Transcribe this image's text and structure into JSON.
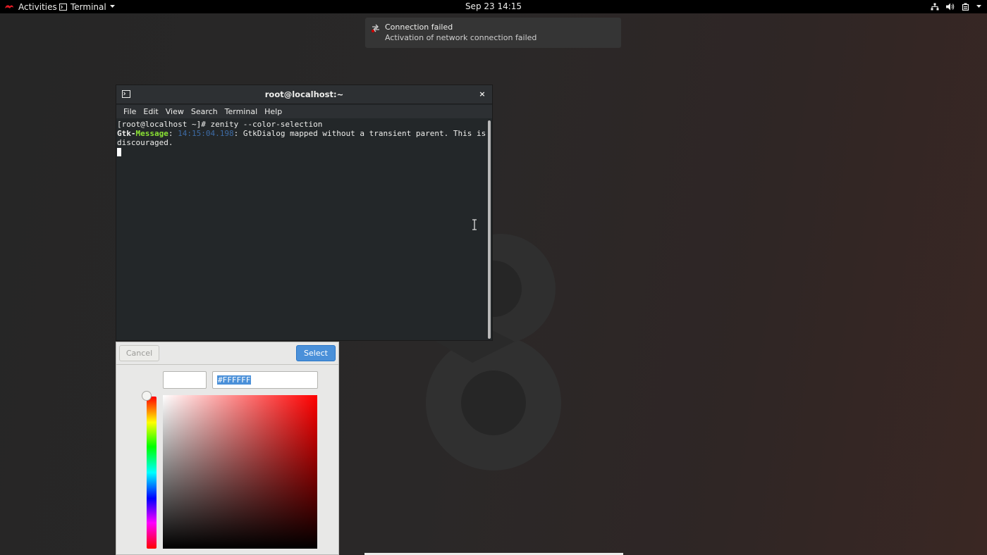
{
  "topbar": {
    "activities_label": "Activities",
    "app_menu_label": "Terminal",
    "clock": "Sep 23  14:15"
  },
  "notification": {
    "title": "Connection failed",
    "body": "Activation of network connection failed"
  },
  "terminal": {
    "title": "root@localhost:~",
    "close_glyph": "×",
    "menu": [
      "File",
      "Edit",
      "View",
      "Search",
      "Terminal",
      "Help"
    ],
    "lines": {
      "prompt_line": "[root@localhost ~]# zenity --color-selection",
      "gtk_prefix": "Gtk-",
      "gtk_message": "Message",
      "colon1": ": ",
      "timestamp": "14:15:04.198",
      "message_rest": ": GtkDialog mapped without a transient parent. This is discouraged."
    }
  },
  "color_dialog": {
    "cancel_label": "Cancel",
    "select_label": "Select",
    "hex_value": "#FFFFFF",
    "accent_color": "#4a90d9",
    "selected_color": "#FFFFFF"
  },
  "icons": {
    "activities": "fedora-logo-icon",
    "app_menu": "terminal-icon",
    "network": "network-icon",
    "volume": "volume-icon",
    "power": "power-icon",
    "notification": "network-error-icon"
  }
}
